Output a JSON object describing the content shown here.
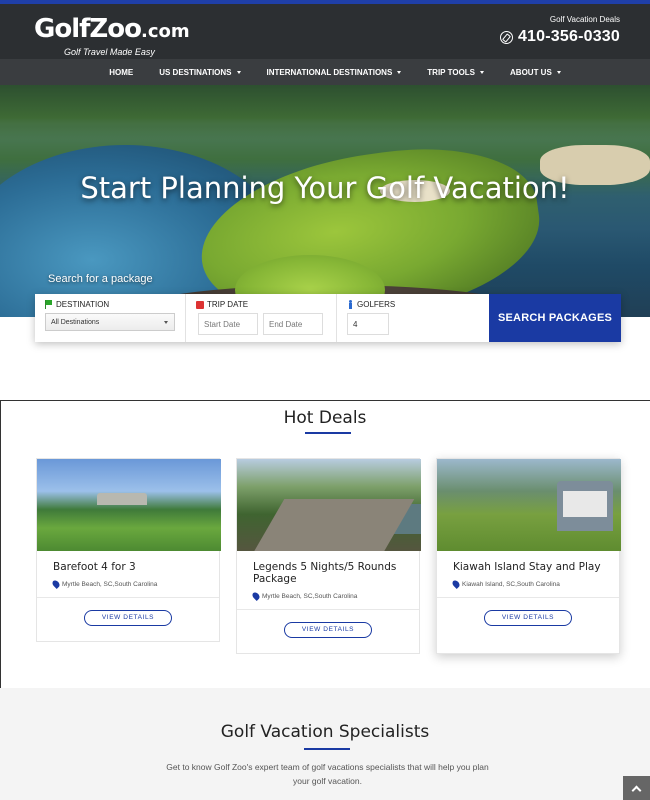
{
  "header": {
    "logo_main": "GolfZoo",
    "logo_suffix": ".com",
    "tagline": "Golf Travel Made Easy",
    "phone_label": "Golf Vacation Deals",
    "phone": "410-356-0330"
  },
  "nav": {
    "items": [
      {
        "label": "HOME"
      },
      {
        "label": "US DESTINATIONS"
      },
      {
        "label": "INTERNATIONAL DESTINATIONS"
      },
      {
        "label": "TRIP TOOLS"
      },
      {
        "label": "ABOUT US"
      }
    ]
  },
  "hero": {
    "title": "Start Planning Your Golf Vacation!",
    "search_label": "Search for a package"
  },
  "search": {
    "destination_label": "DESTINATION",
    "destination_value": "All Destinations",
    "trip_date_label": "TRIP DATE",
    "start_placeholder": "Start Date",
    "end_placeholder": "End Date",
    "golfers_label": "GOLFERS",
    "golfers_value": "4",
    "button": "SEARCH PACKAGES"
  },
  "hot_deals": {
    "title": "Hot Deals",
    "cards": [
      {
        "title": "Barefoot 4 for 3",
        "location": "Myrtle Beach, SC,South Carolina",
        "button": "VIEW DETAILS"
      },
      {
        "title": "Legends 5 Nights/5 Rounds Package",
        "location": "Myrtle Beach, SC,South Carolina",
        "button": "VIEW DETAILS"
      },
      {
        "title": "Kiawah Island Stay and Play",
        "location": "Kiawah Island, SC,South Carolina",
        "button": "VIEW DETAILS"
      }
    ]
  },
  "specialists": {
    "title": "Golf Vacation Specialists",
    "text": "Get to know Golf Zoo's expert team of golf vacations specialists that will help you plan your golf vacation."
  },
  "colors": {
    "accent": "#1a3aa3",
    "header_bg": "#2c2f32",
    "nav_bg": "#3a3d40"
  }
}
